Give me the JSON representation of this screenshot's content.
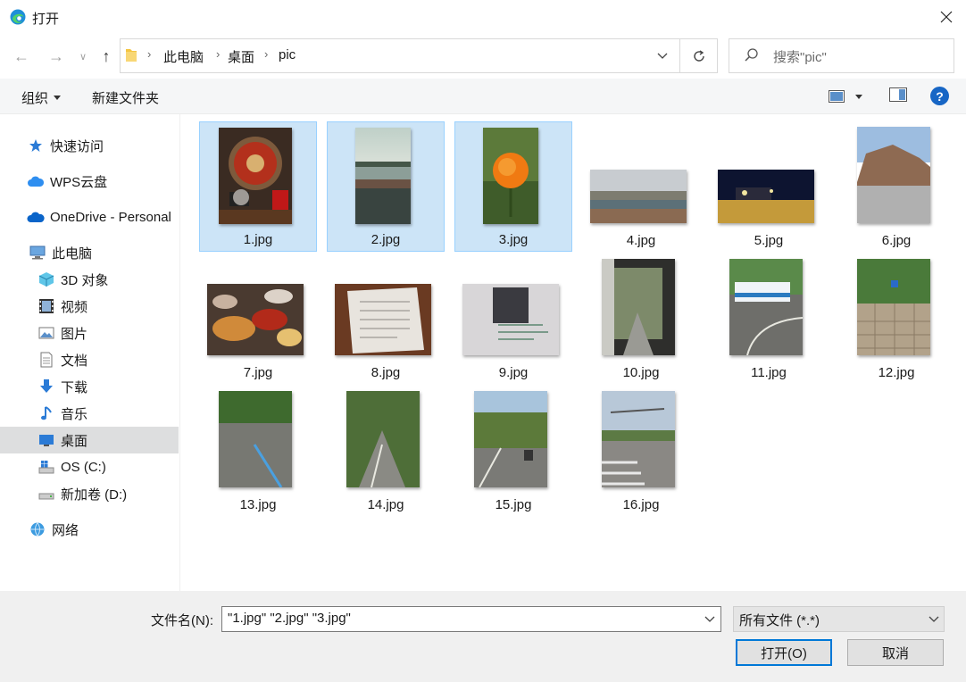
{
  "window": {
    "title": "打开"
  },
  "address": {
    "breadcrumbs": [
      "此电脑",
      "桌面",
      "pic"
    ]
  },
  "search": {
    "placeholder": "搜索\"pic\""
  },
  "toolbar": {
    "organize_label": "组织",
    "new_folder_label": "新建文件夹",
    "help_label": "?"
  },
  "sidebar": {
    "items": [
      {
        "label": "快速访问",
        "icon": "star-icon"
      },
      {
        "label": "WPS云盘",
        "icon": "cloud-icon"
      },
      {
        "label": "OneDrive - Personal",
        "icon": "onedrive-icon"
      },
      {
        "label": "此电脑",
        "icon": "computer-icon"
      },
      {
        "label": "3D 对象",
        "icon": "cube-icon"
      },
      {
        "label": "视频",
        "icon": "video-icon"
      },
      {
        "label": "图片",
        "icon": "picture-icon"
      },
      {
        "label": "文档",
        "icon": "document-icon"
      },
      {
        "label": "下载",
        "icon": "download-icon"
      },
      {
        "label": "音乐",
        "icon": "music-icon"
      },
      {
        "label": "桌面",
        "icon": "desktop-icon",
        "selected": true
      },
      {
        "label": "OS (C:)",
        "icon": "drive-c-icon"
      },
      {
        "label": "新加卷 (D:)",
        "icon": "drive-d-icon"
      },
      {
        "label": "网络",
        "icon": "network-icon"
      }
    ]
  },
  "files": [
    {
      "name": "1.jpg",
      "selected": true
    },
    {
      "name": "2.jpg",
      "selected": true
    },
    {
      "name": "3.jpg",
      "selected": true
    },
    {
      "name": "4.jpg",
      "selected": false
    },
    {
      "name": "5.jpg",
      "selected": false
    },
    {
      "name": "6.jpg",
      "selected": false
    },
    {
      "name": "7.jpg",
      "selected": false
    },
    {
      "name": "8.jpg",
      "selected": false
    },
    {
      "name": "9.jpg",
      "selected": false
    },
    {
      "name": "10.jpg",
      "selected": false
    },
    {
      "name": "11.jpg",
      "selected": false
    },
    {
      "name": "12.jpg",
      "selected": false
    },
    {
      "name": "13.jpg",
      "selected": false
    },
    {
      "name": "14.jpg",
      "selected": false
    },
    {
      "name": "15.jpg",
      "selected": false
    },
    {
      "name": "16.jpg",
      "selected": false
    }
  ],
  "bottom": {
    "filename_label": "文件名(N):",
    "filename_value": "\"1.jpg\" \"2.jpg\" \"3.jpg\"",
    "filetype_value": "所有文件 (*.*)",
    "open_label": "打开(O)",
    "cancel_label": "取消"
  },
  "colors": {
    "accent": "#0078d7",
    "selection": "#cce4f7",
    "help": "#1766c5"
  }
}
